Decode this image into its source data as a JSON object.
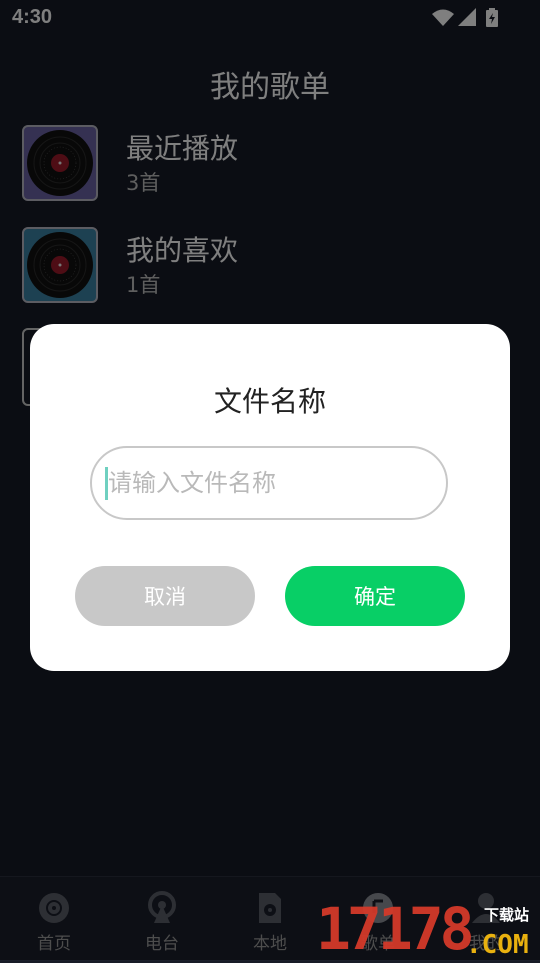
{
  "status_bar": {
    "time": "4:30"
  },
  "page": {
    "title": "我的歌单"
  },
  "playlists": [
    {
      "name": "最近播放",
      "count": "3首",
      "cover_color": "#6b63a4"
    },
    {
      "name": "我的喜欢",
      "count": "1首",
      "cover_color": "#3b83a5"
    }
  ],
  "dialog": {
    "title": "文件名称",
    "input_value": "",
    "input_placeholder": "请输入文件名称",
    "cancel_label": "取消",
    "confirm_label": "确定",
    "confirm_color": "#08cf66"
  },
  "tabs": [
    {
      "label": "首页",
      "icon": "disc-icon"
    },
    {
      "label": "电台",
      "icon": "radio-icon"
    },
    {
      "label": "本地",
      "icon": "local-file-icon"
    },
    {
      "label": "歌单",
      "icon": "playlist-icon"
    },
    {
      "label": "我的",
      "icon": "user-icon"
    }
  ],
  "watermark": {
    "number": "17178",
    "domain": ".COM",
    "site": "下载站"
  }
}
